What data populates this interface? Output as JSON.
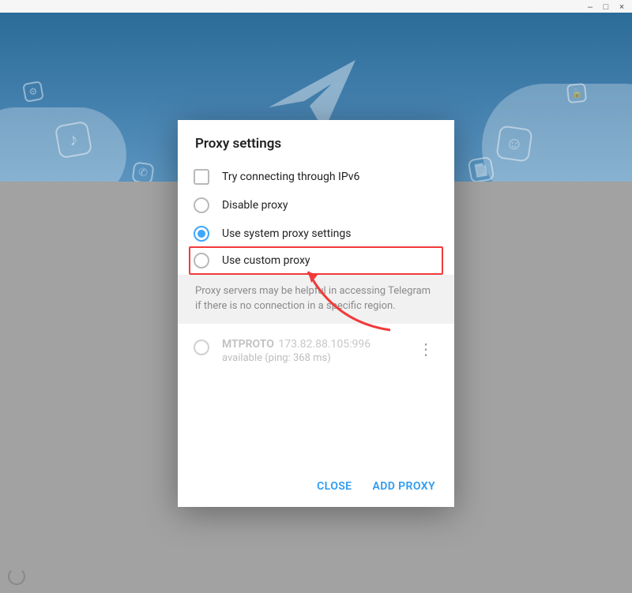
{
  "window": {
    "minimize": "‒",
    "maximize": "□",
    "close": "×"
  },
  "modal": {
    "title": "Proxy settings",
    "options": {
      "ipv6": "Try connecting through IPv6",
      "disable": "Disable proxy",
      "system": "Use system proxy settings",
      "custom": "Use custom proxy"
    },
    "help_text": "Proxy servers may be helpful in accessing Telegram if there is no connection in a specific region.",
    "proxies": [
      {
        "type": "MTPROTO",
        "address": "173.82.88.105:996",
        "status": "available (ping: 368 ms)"
      }
    ],
    "actions": {
      "close": "CLOSE",
      "add": "ADD PROXY"
    }
  }
}
